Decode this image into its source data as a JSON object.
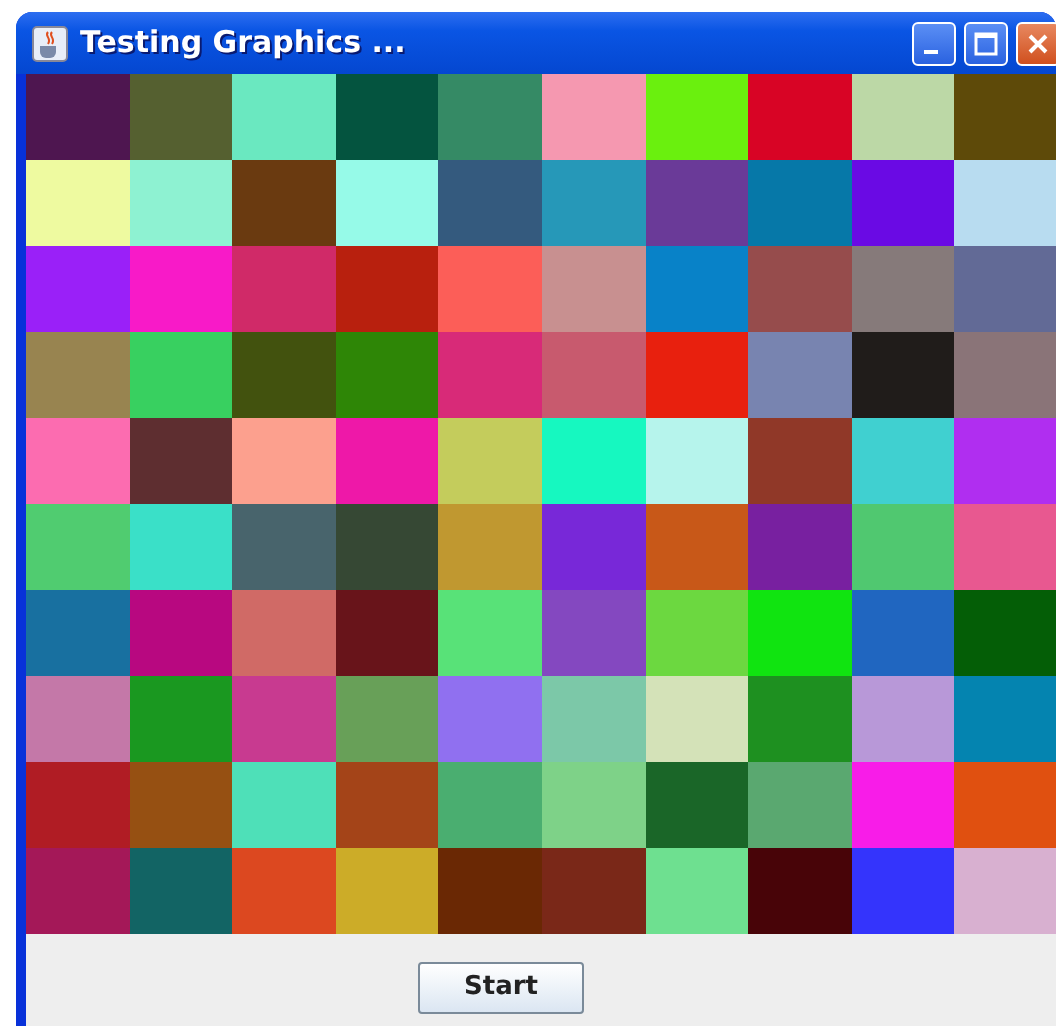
{
  "window": {
    "title": "Testing Graphics ..."
  },
  "grid": {
    "rows": [
      {
        "tiles": [
          {
            "color": "#4e1650"
          },
          {
            "color": "#556030"
          },
          {
            "color": "#6ae8c0"
          },
          {
            "color": "#04543f"
          },
          {
            "color": "#358a65"
          },
          {
            "color": "#f598b0"
          },
          {
            "color": "#6af00e"
          },
          {
            "color": "#d80425"
          },
          {
            "color": "#bcd8a6"
          },
          {
            "color": "#5e4a09"
          }
        ]
      },
      {
        "tiles": [
          {
            "color": "#eefaa0"
          },
          {
            "color": "#8ef2d2"
          },
          {
            "color": "#6a3a10"
          },
          {
            "color": "#96fae8"
          },
          {
            "color": "#345a7e"
          },
          {
            "color": "#2698b8"
          },
          {
            "color": "#6a3a98"
          },
          {
            "color": "#0678a8"
          },
          {
            "color": "#6a0ae4"
          },
          {
            "color": "#b8dcf0"
          }
        ]
      },
      {
        "tiles": [
          {
            "color": "#9a20f8"
          },
          {
            "color": "#f81ac8"
          },
          {
            "color": "#d02a68"
          },
          {
            "color": "#b8200e"
          },
          {
            "color": "#fc5e58"
          },
          {
            "color": "#c89090"
          },
          {
            "color": "#0882c8"
          },
          {
            "color": "#964c4c"
          },
          {
            "color": "#867a7a"
          },
          {
            "color": "#626a96"
          }
        ]
      },
      {
        "tiles": [
          {
            "color": "#988450"
          },
          {
            "color": "#38d060"
          },
          {
            "color": "#42520e"
          },
          {
            "color": "#2e8606"
          },
          {
            "color": "#d82a78"
          },
          {
            "color": "#c85a6e"
          },
          {
            "color": "#e8200e"
          },
          {
            "color": "#7884b0"
          },
          {
            "color": "#201c1a"
          },
          {
            "color": "#8a7478"
          }
        ]
      },
      {
        "tiles": [
          {
            "color": "#fc6cb0"
          },
          {
            "color": "#5e2e30"
          },
          {
            "color": "#fca08e"
          },
          {
            "color": "#ee18a8"
          },
          {
            "color": "#c4cc5c"
          },
          {
            "color": "#16f8c0"
          },
          {
            "color": "#b6f4ec"
          },
          {
            "color": "#903828"
          },
          {
            "color": "#40d0d0"
          },
          {
            "color": "#b02ef0"
          }
        ]
      },
      {
        "tiles": [
          {
            "color": "#50cc70"
          },
          {
            "color": "#3ae0c8"
          },
          {
            "color": "#48646c"
          },
          {
            "color": "#364834"
          },
          {
            "color": "#c09830"
          },
          {
            "color": "#7828d8"
          },
          {
            "color": "#c85818"
          },
          {
            "color": "#7820a0"
          },
          {
            "color": "#50c870"
          },
          {
            "color": "#e85890"
          }
        ]
      },
      {
        "tiles": [
          {
            "color": "#1870a0"
          },
          {
            "color": "#b80880"
          },
          {
            "color": "#d06a66"
          },
          {
            "color": "#68141a"
          },
          {
            "color": "#58e278"
          },
          {
            "color": "#8448c0"
          },
          {
            "color": "#6cd840"
          },
          {
            "color": "#10e410"
          },
          {
            "color": "#2066c0"
          },
          {
            "color": "#045e06"
          }
        ]
      },
      {
        "tiles": [
          {
            "color": "#c478a8"
          },
          {
            "color": "#1a9820"
          },
          {
            "color": "#c83a90"
          },
          {
            "color": "#68a058"
          },
          {
            "color": "#9070f0"
          },
          {
            "color": "#7cc8a8"
          },
          {
            "color": "#d4e2b8"
          },
          {
            "color": "#1e9020"
          },
          {
            "color": "#b898d8"
          },
          {
            "color": "#0484b0"
          }
        ]
      },
      {
        "tiles": [
          {
            "color": "#b01c24"
          },
          {
            "color": "#965012"
          },
          {
            "color": "#4ee0b8"
          },
          {
            "color": "#a44418"
          },
          {
            "color": "#4aae70"
          },
          {
            "color": "#7ed288"
          },
          {
            "color": "#1a6628"
          },
          {
            "color": "#5aa870"
          },
          {
            "color": "#f81ce8"
          },
          {
            "color": "#e05010"
          }
        ]
      },
      {
        "tiles": [
          {
            "color": "#a41858"
          },
          {
            "color": "#126464"
          },
          {
            "color": "#dc4820"
          },
          {
            "color": "#ccac28"
          },
          {
            "color": "#6a2804"
          },
          {
            "color": "#7a2818"
          },
          {
            "color": "#6ee090"
          },
          {
            "color": "#480408"
          },
          {
            "color": "#3434fc"
          },
          {
            "color": "#d8b0d0"
          }
        ]
      }
    ]
  },
  "buttons": [
    "Start"
  ]
}
